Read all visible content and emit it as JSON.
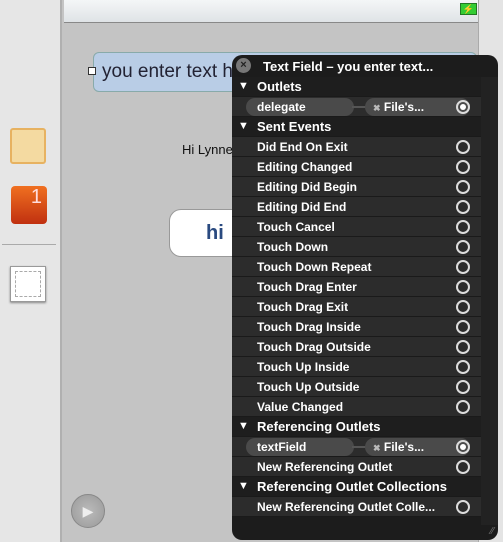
{
  "canvas": {
    "text_field_value": "you enter text here",
    "label": "Hi Lynne",
    "button_label": "hi"
  },
  "hud": {
    "title": "Text Field – you enter text...",
    "sections": {
      "outlets": {
        "label": "Outlets",
        "items": [
          {
            "name": "delegate",
            "target": "File's...",
            "connected": true
          }
        ]
      },
      "sent_events": {
        "label": "Sent Events",
        "items": [
          "Did End On Exit",
          "Editing Changed",
          "Editing Did Begin",
          "Editing Did End",
          "Touch Cancel",
          "Touch Down",
          "Touch Down Repeat",
          "Touch Drag Enter",
          "Touch Drag Exit",
          "Touch Drag Inside",
          "Touch Drag Outside",
          "Touch Up Inside",
          "Touch Up Outside",
          "Value Changed"
        ]
      },
      "referencing_outlets": {
        "label": "Referencing Outlets",
        "items": [
          {
            "name": "textField",
            "target": "File's...",
            "connected": true
          }
        ],
        "new_label": "New Referencing Outlet"
      },
      "referencing_outlet_collections": {
        "label": "Referencing Outlet Collections",
        "new_label": "New Referencing Outlet Colle..."
      }
    }
  },
  "icons": {
    "close": "×",
    "remove": "✖",
    "play": "▶",
    "triangle": "▼"
  }
}
